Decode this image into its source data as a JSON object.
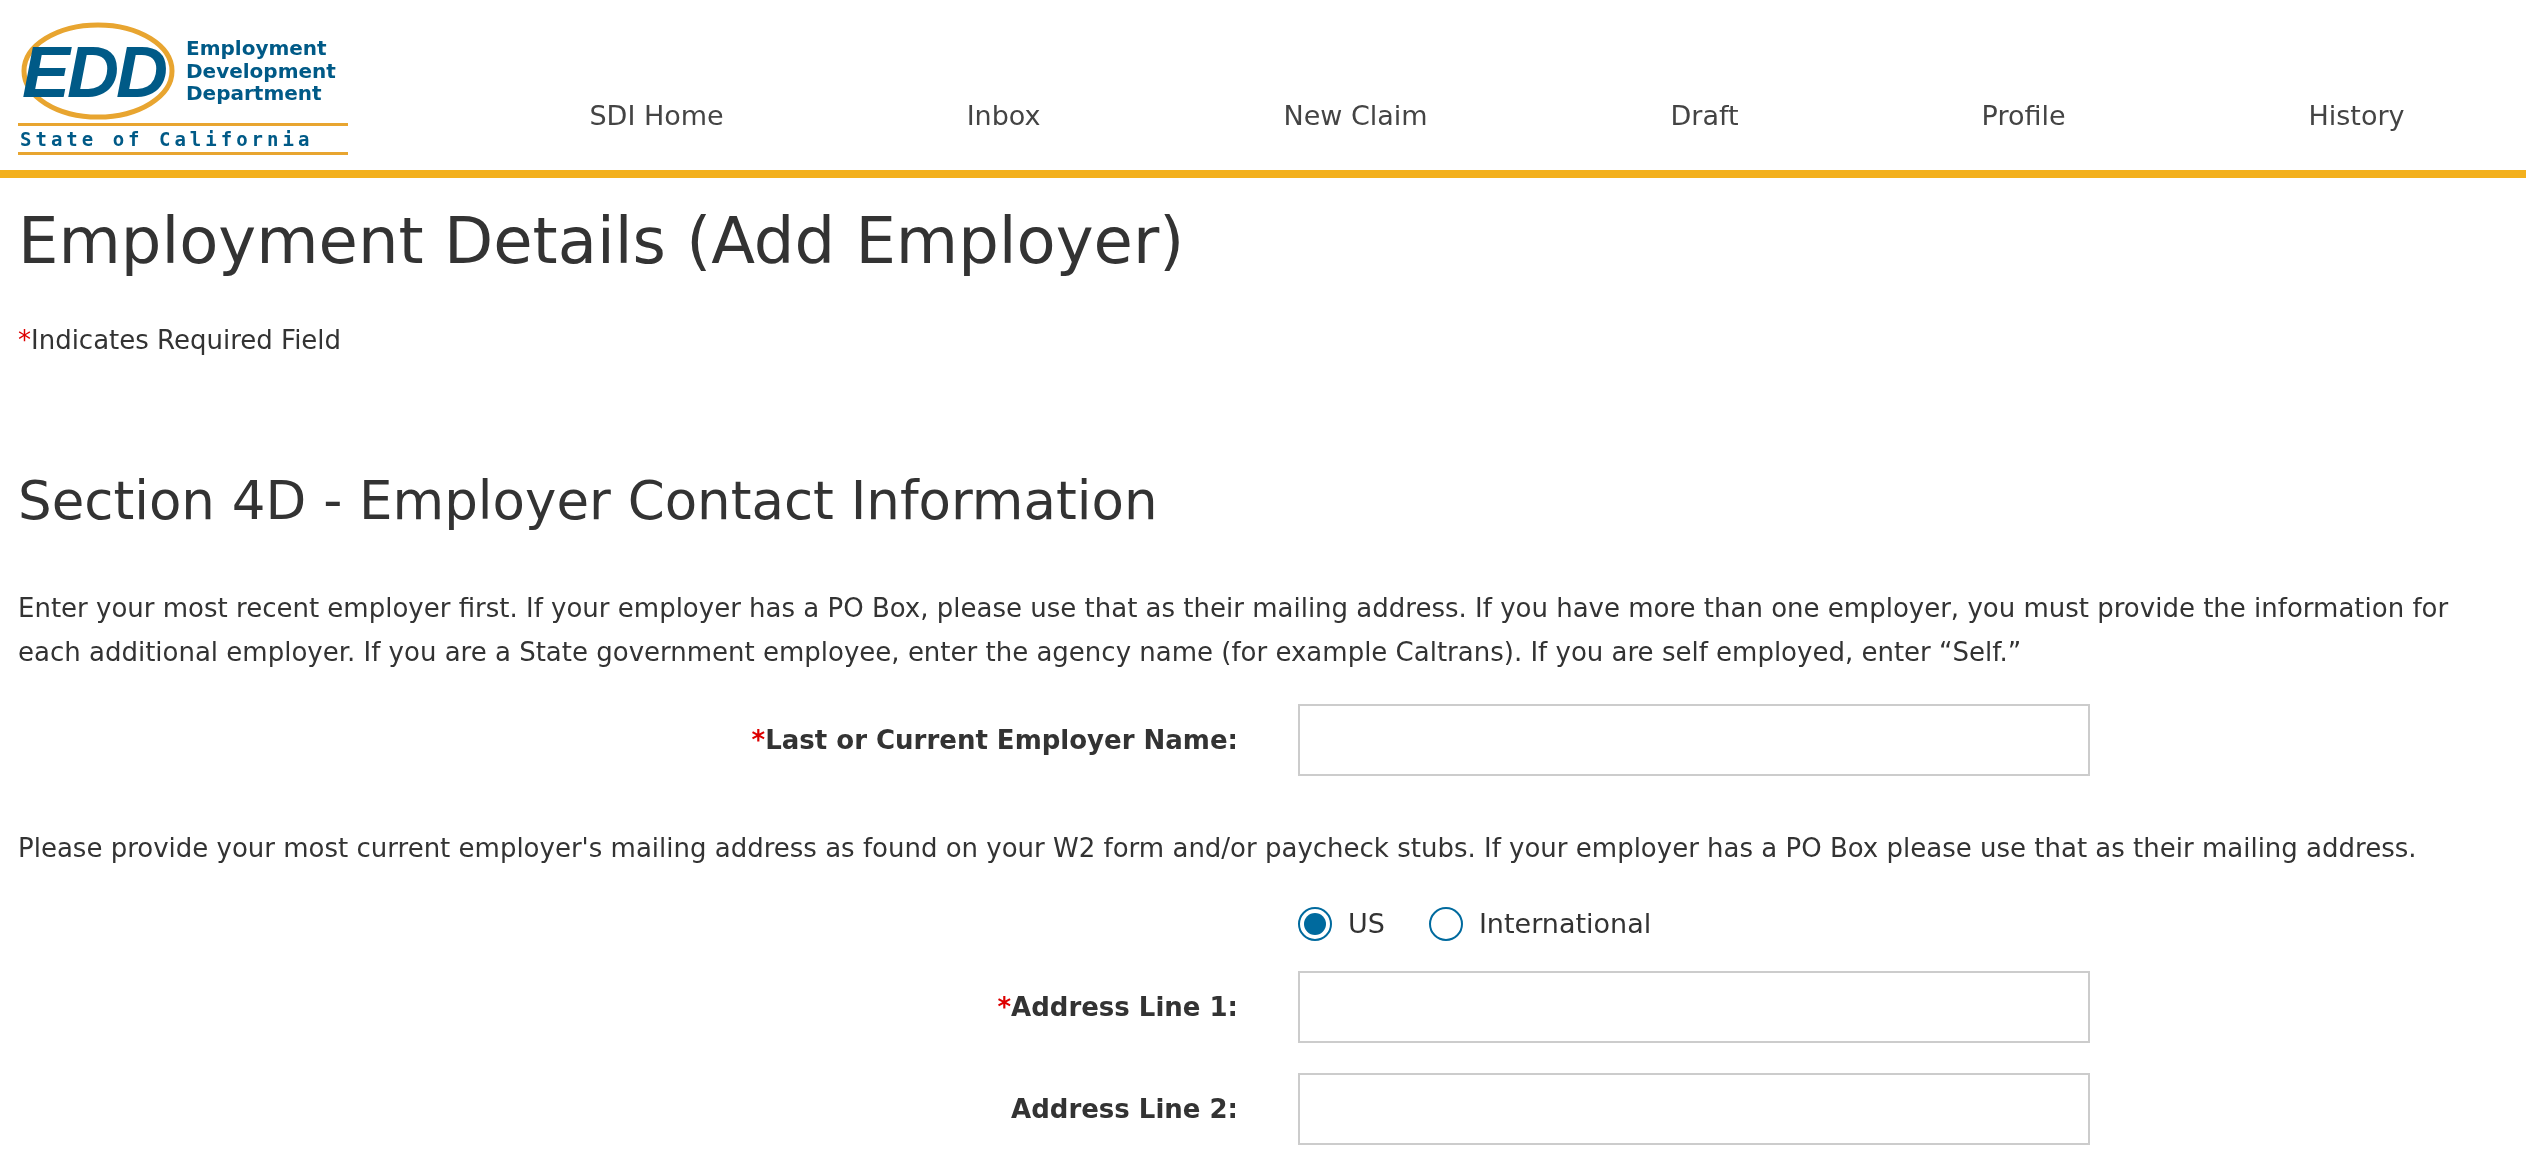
{
  "logo": {
    "mark": "EDD",
    "name_lines": [
      "Employment",
      "Development",
      "Department"
    ],
    "state": "State of California"
  },
  "nav": [
    "SDI Home",
    "Inbox",
    "New Claim",
    "Draft",
    "Profile",
    "History"
  ],
  "title": "Employment Details (Add Employer)",
  "required_note": {
    "mark": "*",
    "text": "Indicates Required Field"
  },
  "section": {
    "heading": "Section 4D - Employer Contact Information",
    "items": [
      {
        "kind": "paragraph",
        "text": "Enter your most recent employer first. If your employer has a PO Box, please use that as their mailing address. If you have more than one employer, you must provide the information for each additional employer. If you are a State government employee, enter the agency name (for example Caltrans). If you are self employed, enter “Self.”"
      },
      {
        "kind": "field",
        "label": "Last or Current Employer Name:",
        "required_mark": "*"
      },
      {
        "kind": "paragraph",
        "text": "Please provide your most current employer's mailing address as found on your W2 form and/or paycheck stubs. If your employer has a PO Box please use that as their mailing address."
      },
      {
        "kind": "radios",
        "options": [
          {
            "label": "US",
            "selected": true
          },
          {
            "label": "International",
            "selected": false
          }
        ]
      },
      {
        "kind": "field",
        "label": "Address Line 1:",
        "required_mark": "*"
      },
      {
        "kind": "field",
        "label": "Address Line 2:"
      }
    ]
  }
}
